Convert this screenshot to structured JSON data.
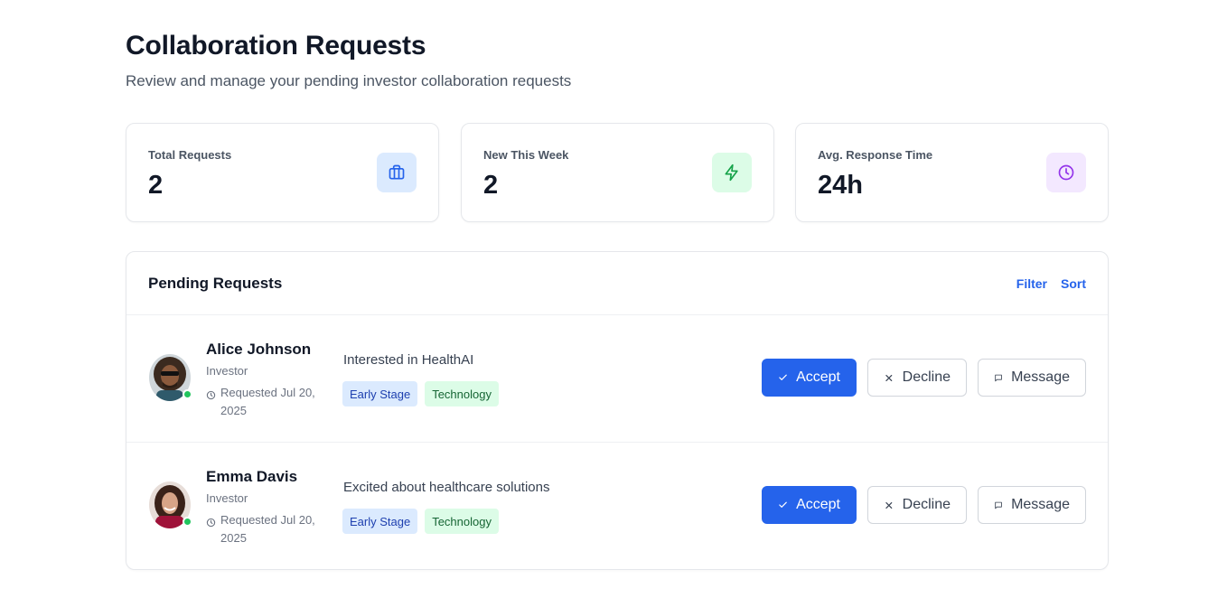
{
  "header": {
    "title": "Collaboration Requests",
    "subtitle": "Review and manage your pending investor collaboration requests"
  },
  "stats": [
    {
      "label": "Total Requests",
      "value": "2",
      "icon": "briefcase-icon",
      "color": "#2563eb",
      "bg": "#dbeafe"
    },
    {
      "label": "New This Week",
      "value": "2",
      "icon": "lightning-icon",
      "color": "#16a34a",
      "bg": "#dcfce7"
    },
    {
      "label": "Avg. Response Time",
      "value": "24h",
      "icon": "clock-icon",
      "color": "#9333ea",
      "bg": "#f3e8ff"
    }
  ],
  "pending": {
    "title": "Pending Requests",
    "filter_label": "Filter",
    "sort_label": "Sort",
    "requests": [
      {
        "name": "Alice Johnson",
        "role": "Investor",
        "requested": "Requested Jul 20, 2025",
        "message": "Interested in HealthAI",
        "tags": [
          "Early Stage",
          "Technology"
        ],
        "accept_label": "Accept",
        "decline_label": "Decline",
        "message_label": "Message"
      },
      {
        "name": "Emma Davis",
        "role": "Investor",
        "requested": "Requested Jul 20, 2025",
        "message": "Excited about healthcare solutions",
        "tags": [
          "Early Stage",
          "Technology"
        ],
        "accept_label": "Accept",
        "decline_label": "Decline",
        "message_label": "Message"
      }
    ]
  },
  "colors": {
    "accent": "#2563eb",
    "online": "#22c55e"
  }
}
